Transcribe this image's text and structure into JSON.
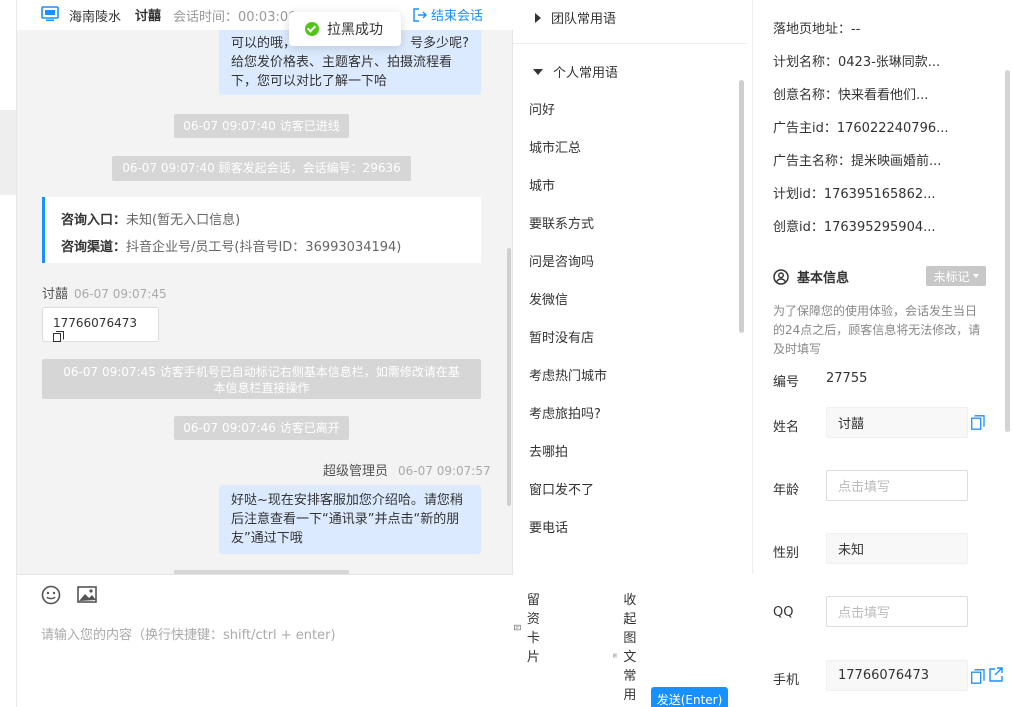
{
  "header": {
    "shop_name": "海南陵水",
    "visitor_name": "讨囍",
    "session_time_label": "会话时间：00:03:00",
    "end_label": "结束会话"
  },
  "toast": {
    "text": "拉黑成功"
  },
  "messages": {
    "agent_bubble_1": [
      "可以的哦，",
      "号多少呢?",
      "给您发价格表、主题客片、拍摄流程看",
      "下，您可以对比了解一下哈"
    ],
    "sys_1": "06-07 09:07:40 访客已进线",
    "sys_2": "06-07 09:07:40 顾客发起会话，会话编号：29636",
    "info_entry_label": "咨询入口：",
    "info_entry_value": "未知(暂无入口信息)",
    "info_channel_label": "咨询渠道：",
    "info_channel_value": "抖音企业号/员工号(抖音号ID：36993034194)",
    "visitor_sender": "讨囍",
    "visitor_time": "06-07 09:07:45",
    "visitor_phone": "17766076473",
    "sys_3": [
      "06-07 09:07:45 访客手机号已自动标记右侧基本信息栏，如需修改请在基",
      "本信息栏直接操作"
    ],
    "sys_4": "06-07 09:07:46 访客已离开",
    "agent_sender": "超级管理员",
    "agent_time": "06-07 09:07:57",
    "agent_bubble_2": [
      "好哒~现在安排客服加您介绍哈。请您稍",
      "后注意查看一下“通讯录”并点击“新的朋",
      "友”通过下哦"
    ]
  },
  "input": {
    "placeholder": "请输入您的内容（换行快捷键：shift/ctrl + enter)",
    "card_label": "留资卡片",
    "collapse_label": "收起图文常用语",
    "send_label": "发送(Enter)"
  },
  "phrases": {
    "team_group": "团队常用语",
    "personal_group": "个人常用语",
    "items": [
      "问好",
      "城市汇总",
      "城市",
      "要联系方式",
      "问是咨询吗",
      "发微信",
      "暂时没有店",
      "考虑热门城市",
      "考虑旅拍吗?",
      "去哪拍",
      "窗口发不了",
      "要电话"
    ]
  },
  "right_panel": {
    "landing_url": "落地页地址：--",
    "plan_name": "计划名称：0423-张琳同款...",
    "creative_name": "创意名称：快来看看他们...",
    "advertiser_id": "广告主id：176022240796...",
    "advertiser_name": "广告主名称：提米映画婚前...",
    "plan_id": "计划id：176395165862...",
    "creative_id": "创意id：176395295904...",
    "basic_info_title": "基本信息",
    "tag_label": "未标记",
    "hint": "为了保障您的使用体验，会话发生当日的24点之后，顾客信息将无法修改，请及时填写",
    "id_label": "编号",
    "id_value": "27755",
    "fields": {
      "name_label": "姓名",
      "name_value": "讨囍",
      "age_label": "年龄",
      "age_placeholder": "点击填写",
      "gender_label": "性别",
      "gender_value": "未知",
      "qq_label": "QQ",
      "qq_placeholder": "点击填写",
      "phone_label": "手机",
      "phone_value": "17766076473"
    }
  },
  "colors": {
    "accent": "#1890ff",
    "agent_bubble": "#dceaff",
    "success": "#52c41a"
  }
}
